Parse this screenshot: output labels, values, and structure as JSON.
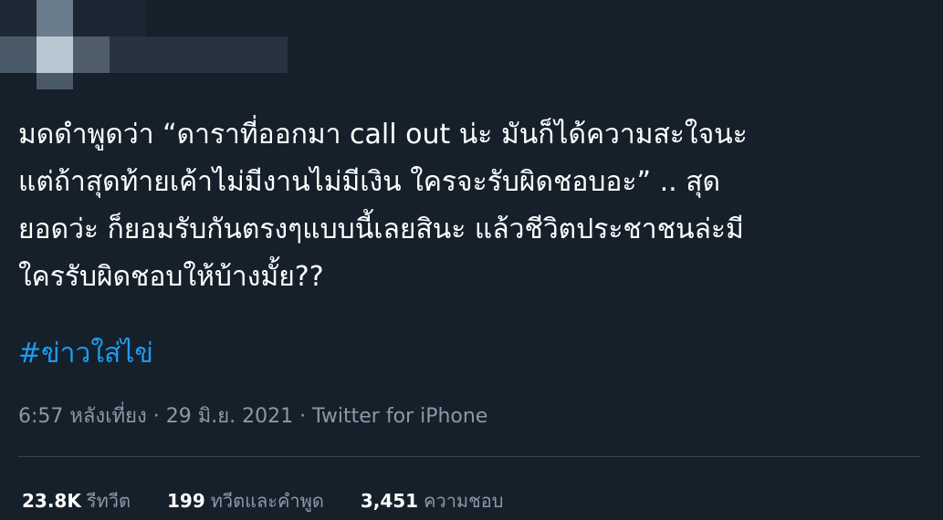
{
  "tweet": {
    "text": "มดดำพูดว่า “ดาราที่ออกมา call out น่ะ มันก็ได้ความสะใจนะ\nแต่ถ้าสุดท้ายเค้าไม่มีงานไม่มีเงิน ใครจะรับผิดชอบอะ” .. สุด\nยอดว่ะ ก็ยอมรับกันตรงๆแบบนี้เลยสินะ แล้วชีวิตประชาชนล่ะมี\nใครรับผิดชอบให้บ้างมั้ย??",
    "hashtag": "#ข่าวใส่ไข่"
  },
  "meta": {
    "time": "6:57 หลังเที่ยง",
    "separator1": " · ",
    "date": "29 มิ.ย. 2021",
    "separator2": " · ",
    "source": "Twitter for iPhone"
  },
  "stats": {
    "retweets": {
      "count": "23.8K",
      "label": "รีทวีต"
    },
    "quotes": {
      "count": "199",
      "label": "ทวีตและคำพูด"
    },
    "likes": {
      "count": "3,451",
      "label": "ความชอบ"
    }
  },
  "colors": {
    "background": "#15202b",
    "text": "#ffffff",
    "link": "#1d9bf0",
    "secondary": "#8b98a5",
    "divider": "#38444d"
  }
}
